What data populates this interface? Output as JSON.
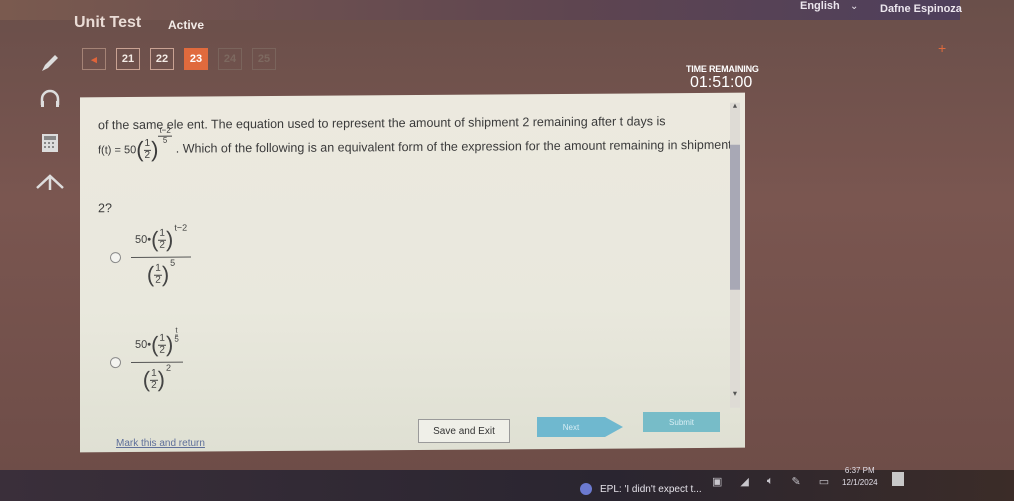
{
  "header": {
    "language": "English",
    "user_name": "Dafne Espinoza",
    "test_title": "Unit Test",
    "test_status": "Active"
  },
  "question_nav": {
    "prev_icon": "◂",
    "items": [
      {
        "label": "21",
        "state": "normal"
      },
      {
        "label": "22",
        "state": "normal"
      },
      {
        "label": "23",
        "state": "active"
      },
      {
        "label": "24",
        "state": "disabled"
      },
      {
        "label": "25",
        "state": "disabled"
      }
    ]
  },
  "tools": [
    "pencil-icon",
    "headphones-icon",
    "calculator-icon",
    "reference-icon"
  ],
  "timer": {
    "label": "TIME REMAINING",
    "value": "01:51:00"
  },
  "question": {
    "line1": "of the same ele   ent. The equation used to represent the amount of shipment 2 remaining after t days is",
    "formula_prefix": "f(t) = 50",
    "base_num": "1",
    "base_den": "2",
    "exp_num": "t−2",
    "exp_den": "5",
    "line2": ". Which of the following is an equivalent form of the expression for the amount remaining in shipment",
    "line3": "2?"
  },
  "options": [
    {
      "coef": "50•",
      "top_exp": "t−2",
      "bottom_exp": "5"
    },
    {
      "coef": "50•",
      "top_exp_num": "t",
      "top_exp_den": "5",
      "bottom_exp": "2"
    }
  ],
  "footer": {
    "mark_label": "Mark this and return",
    "save_label": "Save and Exit",
    "next_label": "Next",
    "submit_label": "Submit"
  },
  "taskbar": {
    "news_text": "EPL: 'I didn't expect t...",
    "time": "6:37 PM",
    "date": "12/1/2024"
  },
  "colors": {
    "accent": "#e06a3d",
    "button_teal": "#6fb8cf",
    "link": "#5f6f9a"
  }
}
